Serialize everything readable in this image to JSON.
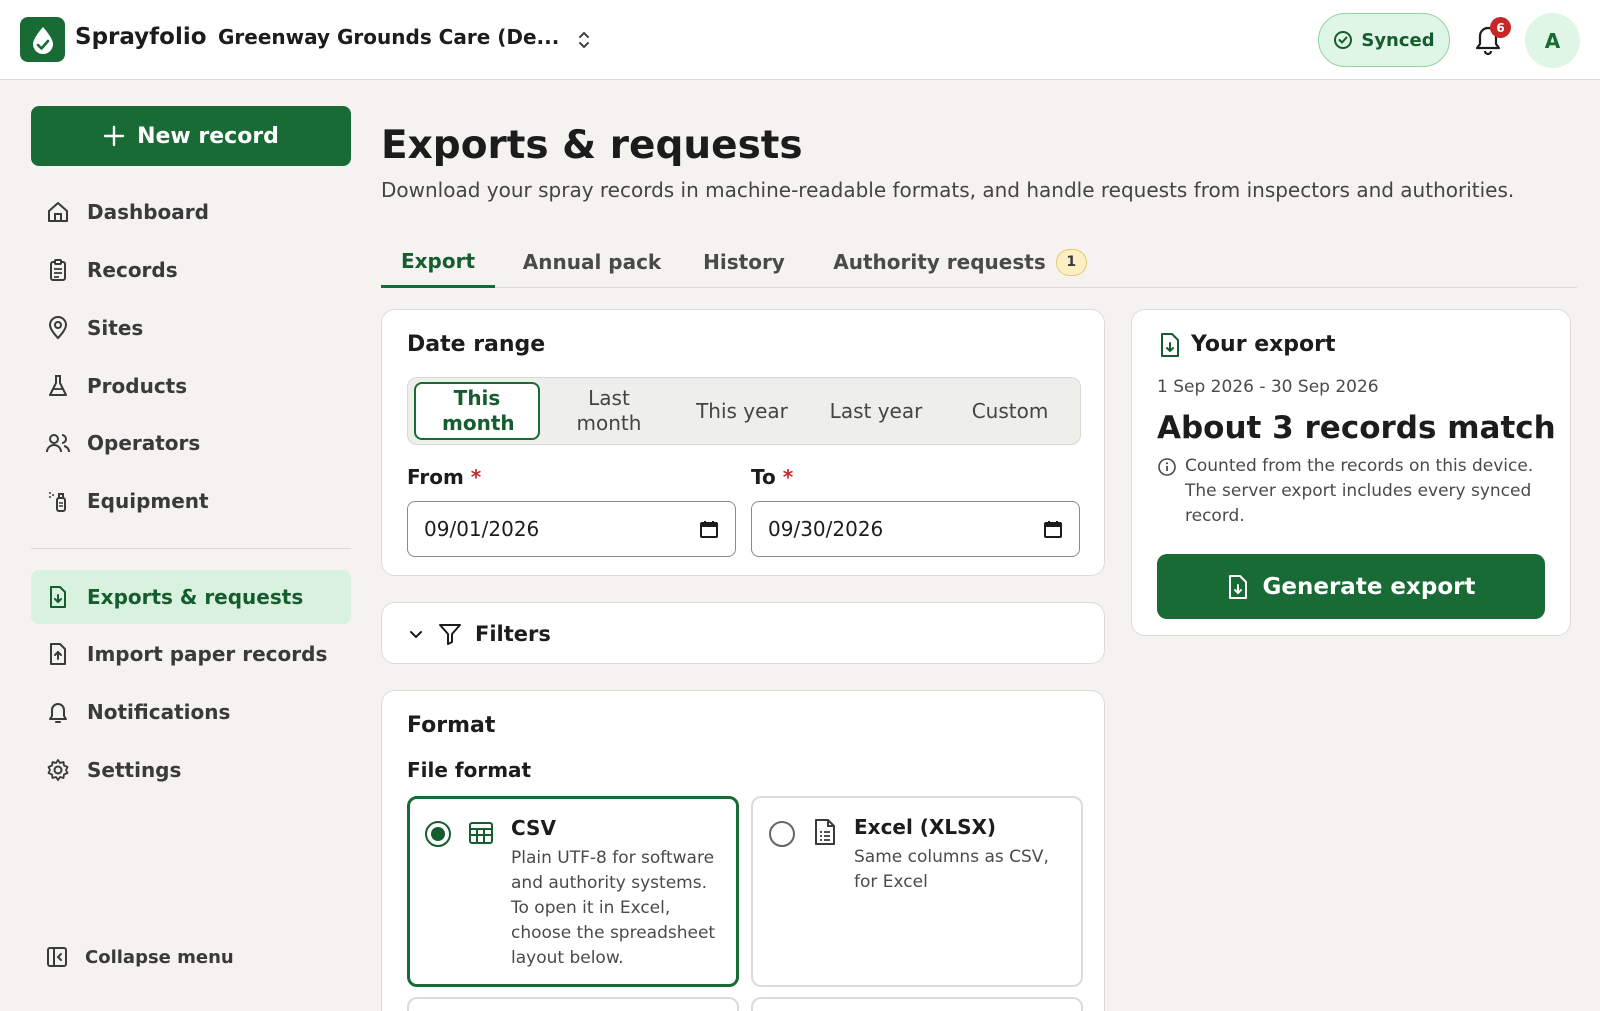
{
  "app": {
    "brand": "Sprayfolio",
    "org_name": "Greenway Grounds Care (De...",
    "sync_status": "Synced",
    "notification_count": "6",
    "avatar_initial": "A",
    "accent_color": "#186b35"
  },
  "sidebar": {
    "new_record_label": "New record",
    "items": [
      {
        "label": "Dashboard",
        "icon": "home-icon"
      },
      {
        "label": "Records",
        "icon": "clipboard-icon"
      },
      {
        "label": "Sites",
        "icon": "map-pin-icon"
      },
      {
        "label": "Products",
        "icon": "flask-icon"
      },
      {
        "label": "Operators",
        "icon": "users-icon"
      },
      {
        "label": "Equipment",
        "icon": "sprayer-icon"
      }
    ],
    "secondary_items": [
      {
        "label": "Exports & requests",
        "icon": "file-download-icon",
        "active": true
      },
      {
        "label": "Import paper records",
        "icon": "file-upload-icon"
      },
      {
        "label": "Notifications",
        "icon": "bell-icon"
      },
      {
        "label": "Settings",
        "icon": "gear-icon"
      }
    ],
    "collapse_label": "Collapse menu"
  },
  "page": {
    "title": "Exports & requests",
    "subtitle": "Download your spray records in machine-readable formats, and handle requests from inspectors and authorities."
  },
  "tabs": [
    {
      "label": "Export",
      "active": true
    },
    {
      "label": "Annual pack"
    },
    {
      "label": "History"
    },
    {
      "label": "Authority requests",
      "badge": "1"
    }
  ],
  "date_range": {
    "title": "Date range",
    "presets": [
      "This month",
      "Last month",
      "This year",
      "Last year",
      "Custom"
    ],
    "selected_preset": "This month",
    "from_label": "From",
    "to_label": "To",
    "required_mark": "*",
    "from_value": "09/01/2026",
    "to_value": "09/30/2026"
  },
  "filters": {
    "label": "Filters"
  },
  "format": {
    "title": "Format",
    "file_format_label": "File format",
    "options": [
      {
        "title": "CSV",
        "desc": "Plain UTF-8 for software and authority systems. To open it in Excel, choose the spreadsheet layout below.",
        "icon": "table-icon",
        "selected": true
      },
      {
        "title": "Excel (XLSX)",
        "desc": "Same columns as CSV, for Excel",
        "icon": "document-icon",
        "selected": false
      }
    ]
  },
  "export_summary": {
    "title": "Your export",
    "range": "1 Sep 2026 - 30 Sep 2026",
    "count_text": "About 3 records match",
    "note": "Counted from the records on this device. The server export includes every synced record.",
    "button_label": "Generate export"
  }
}
